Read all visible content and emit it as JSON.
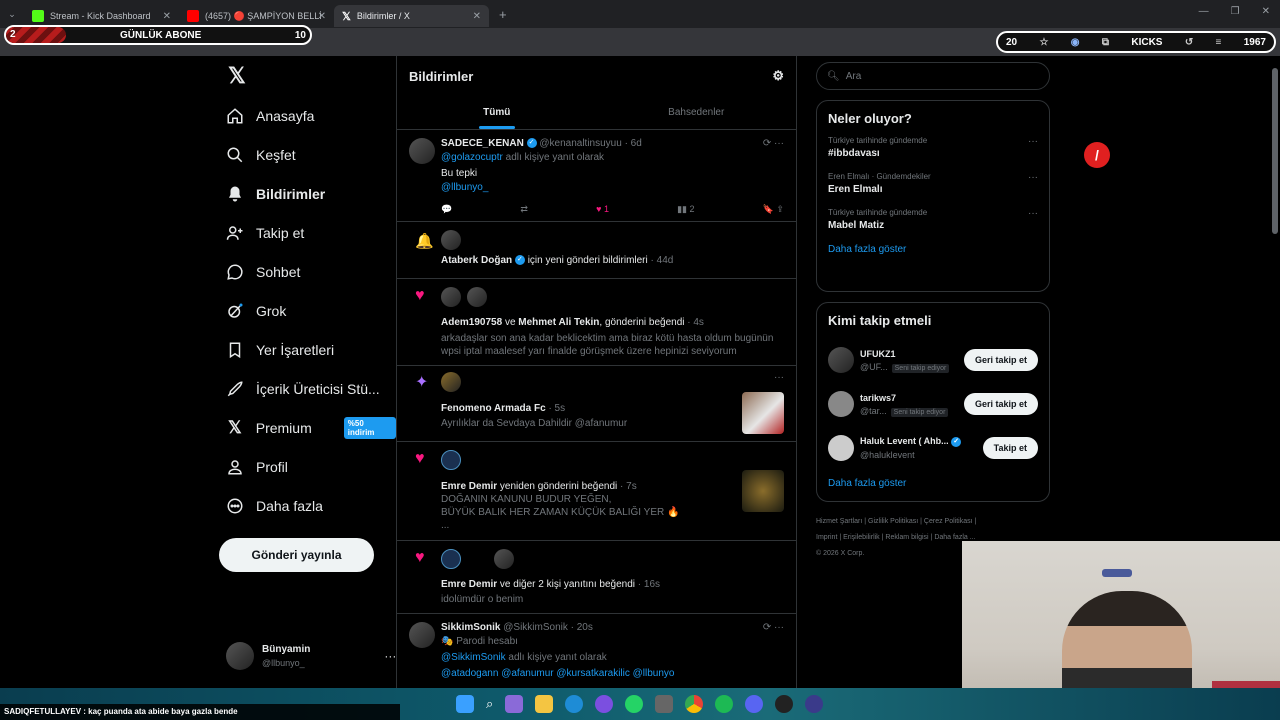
{
  "browser": {
    "tabs": [
      {
        "title": "Stream - Kick Dashboard",
        "active": false,
        "favicon_color": "#53fc18"
      },
      {
        "title": "(4657) 🔴 ŞAMPİYON BELLİ OL",
        "active": false,
        "favicon_color": "#ff0000"
      },
      {
        "title": "Bildirimler / X",
        "active": true,
        "favicon_color": "#ffffff"
      }
    ],
    "url": "x.com/notifications"
  },
  "overlay": {
    "subs_count": "2",
    "subs_label": "GÜNLÜK ABONE",
    "subs_goal": "10",
    "kick_label": "KICKS",
    "kick_left": "20",
    "kick_count": "1967",
    "chat_line": "SADIQFETULLAYEV : kaç puanda ata abide baya gazla bende"
  },
  "sidebar": {
    "items": [
      {
        "label": "Anasayfa",
        "icon": "home-icon"
      },
      {
        "label": "Keşfet",
        "icon": "search-icon"
      },
      {
        "label": "Bildirimler",
        "icon": "bell-icon"
      },
      {
        "label": "Takip et",
        "icon": "add-user-icon"
      },
      {
        "label": "Sohbet",
        "icon": "chat-icon"
      },
      {
        "label": "Grok",
        "icon": "grok-icon"
      },
      {
        "label": "Yer İşaretleri",
        "icon": "bookmark-icon"
      },
      {
        "label": "İçerik Üreticisi Stü...",
        "icon": "rocket-icon"
      },
      {
        "label": "Premium",
        "icon": "x-icon"
      },
      {
        "label": "Profil",
        "icon": "profile-icon"
      },
      {
        "label": "Daha fazla",
        "icon": "more-icon"
      }
    ],
    "premium_badge": "%50 indirim",
    "post_button": "Gönderi yayınla",
    "profile_name": "Bünyamin",
    "profile_handle": "@llbunyo_"
  },
  "feed": {
    "title": "Bildirimler",
    "tabs": [
      "Tümü",
      "Bahsedenler"
    ],
    "n1": {
      "name": "SADECE_KENAN",
      "handle": "@kenanaltinsuyuu · 6d",
      "reply_to": "@golazocuptr",
      "reply_suffix": "adlı kişiye yanıt olarak",
      "text": "Bu tepki",
      "mention": "@llbunyo_",
      "likes": "1",
      "views": "2"
    },
    "n2": {
      "name": "Ataberk Doğan",
      "text": "için yeni gönderi bildirimleri",
      "time": "· 44d"
    },
    "n3": {
      "name1": "Adem190758",
      "and": "ve",
      "name2": "Mehmet Ali Tekin",
      "action": ", gönderini beğendi",
      "time": "· 4s",
      "text": "arkadaşlar son ana kadar beklicektim ama biraz kötü hasta oldum bugünün wpsi iptal maalesef yarı finalde görüşmek üzere hepinizi seviyorum"
    },
    "n4": {
      "name": "Fenomeno Armada Fc",
      "time": "· 5s",
      "text": "Ayrılıklar da Sevdaya Dahildir @afanumur"
    },
    "n5": {
      "name": "Emre Demir",
      "action": "yeniden gönderini beğendi",
      "time": "· 7s",
      "line1": "DOĞANIN KANUNU BUDUR YEĞEN,",
      "line2": "BÜYÜK BALIK HER ZAMAN KÜÇÜK BALIĞI YER",
      "line3": "..."
    },
    "n6": {
      "name": "Emre Demir",
      "action": "ve diğer 2 kişi yanıtını beğendi",
      "time": "· 16s",
      "text": "idolümdür o benim"
    },
    "n7": {
      "name": "SikkimSonik",
      "handle": "@SikkimSonik · 20s",
      "parody": "Parodi hesabı",
      "reply_to": "@SikkimSonik",
      "reply_suffix": "adlı kişiye yanıt olarak",
      "mentions": "@atadogann @afanumur @kursatkarakilic @llbunyo"
    }
  },
  "right": {
    "search_placeholder": "Ara",
    "trends_title": "Neler oluyor?",
    "trends": [
      {
        "context": "Türkiye tarihinde gündemde",
        "name": "#ibbdavası"
      },
      {
        "context": "Eren Elmalı · Gündemdekiler",
        "name": "Eren Elmalı"
      },
      {
        "context": "Türkiye tarihinde gündemde",
        "name": "Mabel Matiz"
      }
    ],
    "show_more": "Daha fazla göster",
    "who_title": "Kimi takip etmeli",
    "who": [
      {
        "name": "UFUKZ1",
        "handle": "@UF...",
        "tag": "Seni takip ediyor",
        "button": "Geri takip et"
      },
      {
        "name": "tarikws7",
        "handle": "@tar...",
        "tag": "Seni takip ediyor",
        "button": "Geri takip et"
      },
      {
        "name": "Haluk Levent ( Ahb...",
        "handle": "@haluklevent",
        "tag": "",
        "button": "Takip et"
      }
    ],
    "footer": [
      "Hizmet Şartları",
      "Gizlilik Politikası",
      "Çerez Politikası",
      "Imprint",
      "Erişilebilirlik",
      "Reklam bilgisi",
      "Daha fazla ...",
      "© 2026 X Corp."
    ]
  }
}
